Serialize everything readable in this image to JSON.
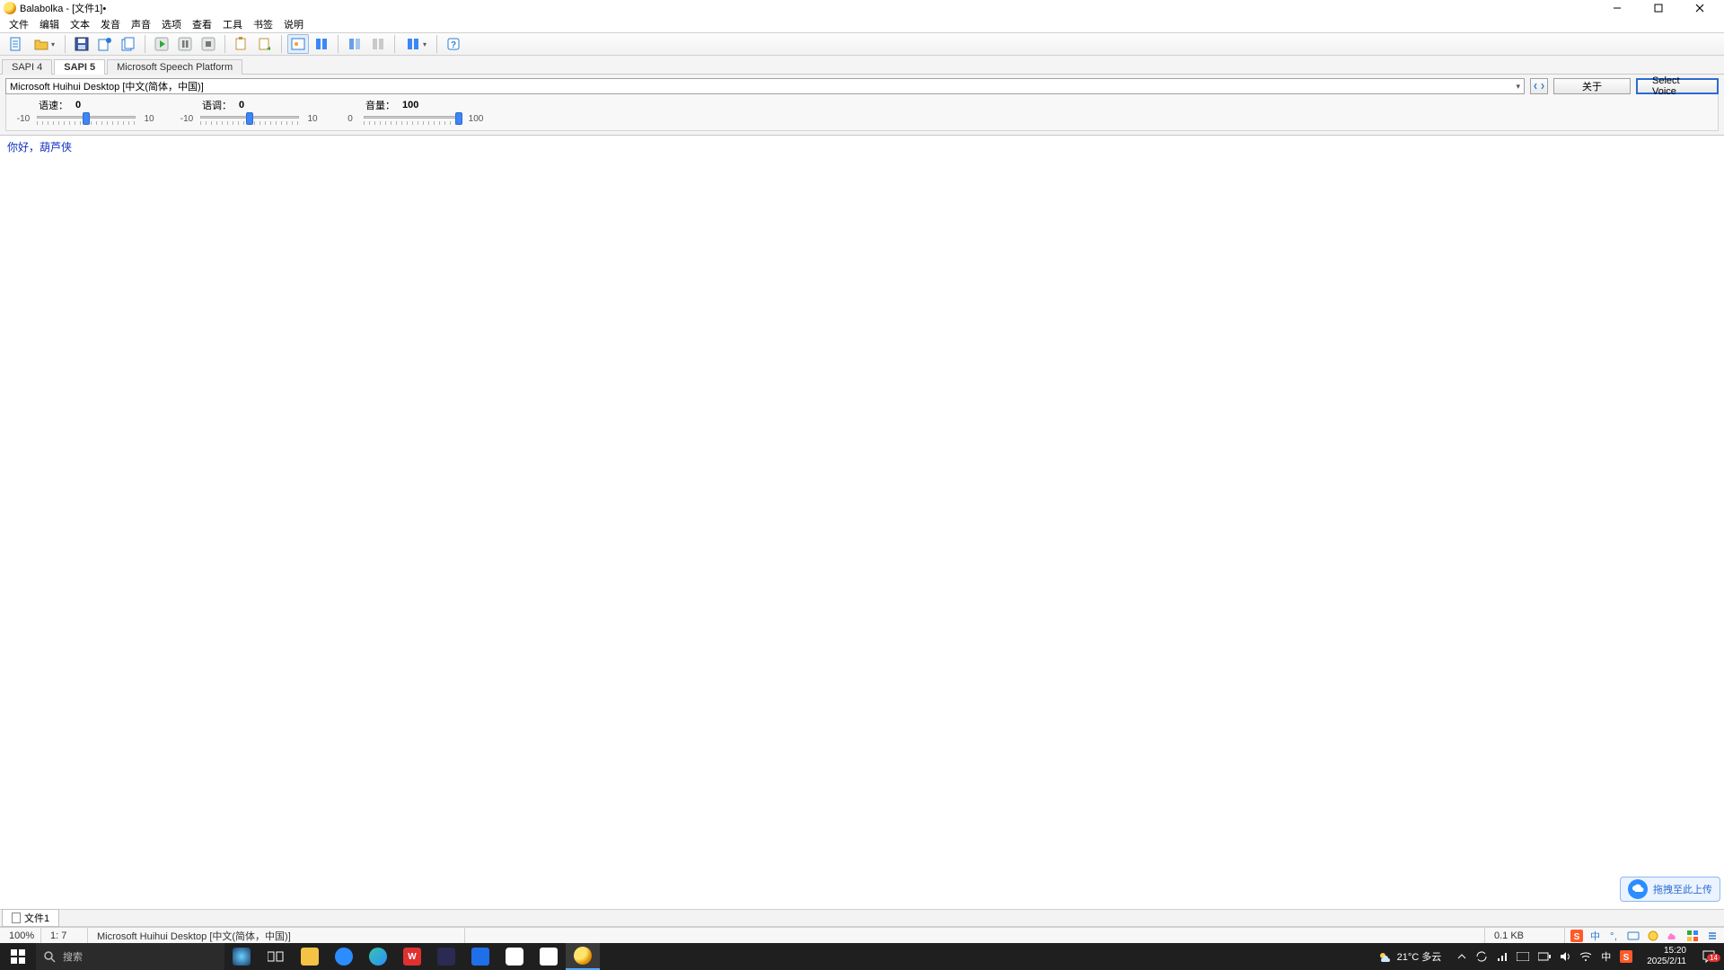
{
  "titlebar": {
    "title": "Balabolka - [文件1]•"
  },
  "menu": {
    "items": [
      "文件",
      "编辑",
      "文本",
      "发音",
      "声音",
      "选项",
      "查看",
      "工具",
      "书签",
      "说明"
    ]
  },
  "apitabs": {
    "items": [
      "SAPI 4",
      "SAPI 5",
      "Microsoft Speech Platform"
    ],
    "active": 1
  },
  "voice": {
    "selected": "Microsoft Huihui Desktop [中文(简体，中国)]",
    "about": "关于",
    "select": "Select Voice"
  },
  "sliders": {
    "rate": {
      "label": "语速：",
      "value": "0",
      "min": "-10",
      "max": "10"
    },
    "pitch": {
      "label": "语调：",
      "value": "0",
      "min": "-10",
      "max": "10"
    },
    "vol": {
      "label": "音量：",
      "value": "100",
      "min": "0",
      "max": "100"
    }
  },
  "editor": {
    "text": "你好，葫芦侠"
  },
  "doctabs": {
    "items": [
      "文件1"
    ]
  },
  "status": {
    "zoom": "100%",
    "pos": "1:  7",
    "voice": "Microsoft Huihui Desktop [中文(简体，中国)]",
    "size": "0.1 KB"
  },
  "upload_float": "拖拽至此上传",
  "taskbar": {
    "search_placeholder": "搜索",
    "weather": "21°C 多云",
    "time": "15:20",
    "date": "2025/2/11",
    "notif_count": "14",
    "ime": "中"
  }
}
